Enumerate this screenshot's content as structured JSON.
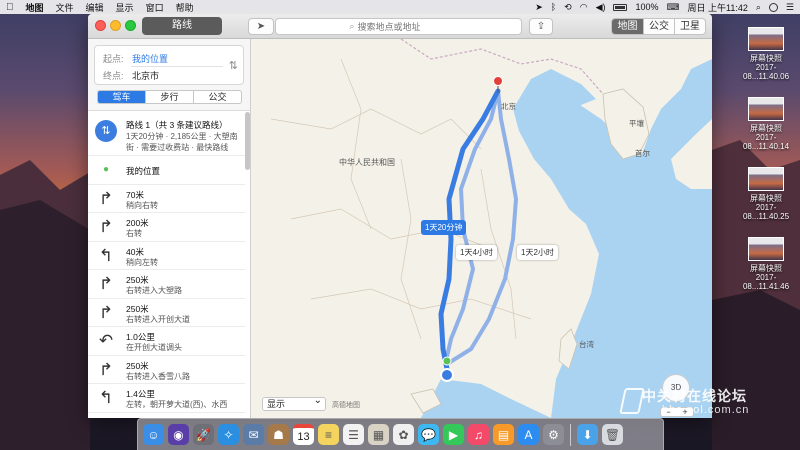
{
  "menubar": {
    "items": [
      "地图",
      "文件",
      "编辑",
      "显示",
      "窗口",
      "帮助"
    ],
    "battery": "100%",
    "clock": "周日 上午11:42"
  },
  "window": {
    "title_toggle": "路线",
    "search_placeholder": "搜索地点或地址",
    "view_modes": [
      "地图",
      "公交",
      "卫星"
    ]
  },
  "directions": {
    "start_label": "起点:",
    "start_value": "我的位置",
    "end_label": "终点:",
    "end_value": "北京市",
    "modes": [
      "驾车",
      "步行",
      "公交"
    ],
    "summary_title": "路线 1（共 3 条建议路线）",
    "summary_detail": "1天20分钟 · 2,185公里 · 大塑南街 · 需要过收费站 · 最快路线",
    "steps": [
      {
        "icon": "pin-icon",
        "glyph": "●",
        "main": "我的位置",
        "sub": ""
      },
      {
        "icon": "turn-right-icon",
        "glyph": "↱",
        "main": "70米",
        "sub": "稍向右转"
      },
      {
        "icon": "turn-right-icon",
        "glyph": "↱",
        "main": "200米",
        "sub": "右转"
      },
      {
        "icon": "turn-left-icon",
        "glyph": "↰",
        "main": "40米",
        "sub": "稍向左转"
      },
      {
        "icon": "turn-right-icon",
        "glyph": "↱",
        "main": "250米",
        "sub": "右转进入大塑路"
      },
      {
        "icon": "turn-right-icon",
        "glyph": "↱",
        "main": "250米",
        "sub": "右转进入开创大道"
      },
      {
        "icon": "u-turn-icon",
        "glyph": "↶",
        "main": "1.0公里",
        "sub": "在开创大道调头"
      },
      {
        "icon": "turn-right-icon",
        "glyph": "↱",
        "main": "250米",
        "sub": "右转进入香雪八路"
      },
      {
        "icon": "turn-left-icon",
        "glyph": "↰",
        "main": "1.4公里",
        "sub": "左转，朝开萝大道(西)、水西"
      }
    ]
  },
  "map": {
    "labels": {
      "beijing": "北京",
      "pyongyang": "平壤",
      "seoul": "首尔",
      "china": "中华人民共和国",
      "taiwan": "台湾"
    },
    "route_times": [
      "1天20分钟",
      "1天4小时",
      "1天2小时"
    ],
    "display_select": "显示",
    "legal": "高德地图",
    "compass": "3D",
    "zoom_minus": "−",
    "zoom_plus": "+"
  },
  "desktop": {
    "files": [
      {
        "name": "屏幕快照",
        "date": "2017-08...11.40.06"
      },
      {
        "name": "屏幕快照",
        "date": "2017-08...11.40.14"
      },
      {
        "name": "屏幕快照",
        "date": "2017-08...11.40.25"
      },
      {
        "name": "屏幕快照",
        "date": "2017-08...11.41.46"
      }
    ]
  },
  "watermark": {
    "brand": "中关村在线论坛",
    "url": "bbs.zol.com.cn"
  },
  "dock": {
    "calendar_day": "13",
    "apps": [
      {
        "name": "finder-icon",
        "color": "#3a8ee6",
        "glyph": "☺"
      },
      {
        "name": "siri-icon",
        "color": "#5a3ea8",
        "glyph": "◉"
      },
      {
        "name": "launchpad-icon",
        "color": "#6f6f78",
        "glyph": "🚀"
      },
      {
        "name": "safari-icon",
        "color": "#2a8fe0",
        "glyph": "✧"
      },
      {
        "name": "mail-stamp-icon",
        "color": "#5a7ca6",
        "glyph": "✉"
      },
      {
        "name": "contacts-icon",
        "color": "#a5794a",
        "glyph": "☗"
      },
      {
        "name": "calendar-icon",
        "color": "#ffffff",
        "glyph": ""
      },
      {
        "name": "notes-icon",
        "color": "#f4d35e",
        "glyph": "≡"
      },
      {
        "name": "reminders-icon",
        "color": "#f2f2f2",
        "glyph": "☰"
      },
      {
        "name": "photos-slides-icon",
        "color": "#d9d3c5",
        "glyph": "▦"
      },
      {
        "name": "photos-icon",
        "color": "#f0f0f0",
        "glyph": "✿"
      },
      {
        "name": "messages-icon",
        "color": "#3eb8f0",
        "glyph": "💬"
      },
      {
        "name": "facetime-icon",
        "color": "#34c759",
        "glyph": "▶"
      },
      {
        "name": "music-icon",
        "color": "#f44a6a",
        "glyph": "♫"
      },
      {
        "name": "ibooks-icon",
        "color": "#f79a2a",
        "glyph": "▤"
      },
      {
        "name": "app-store-icon",
        "color": "#2d8cf0",
        "glyph": "A"
      },
      {
        "name": "system-prefs-icon",
        "color": "#8d8d95",
        "glyph": "⚙"
      },
      {
        "name": "downloads-icon",
        "color": "#4aa3e8",
        "glyph": "⬇"
      },
      {
        "name": "trash-icon",
        "color": "#d7dbe0",
        "glyph": "🗑"
      }
    ]
  }
}
